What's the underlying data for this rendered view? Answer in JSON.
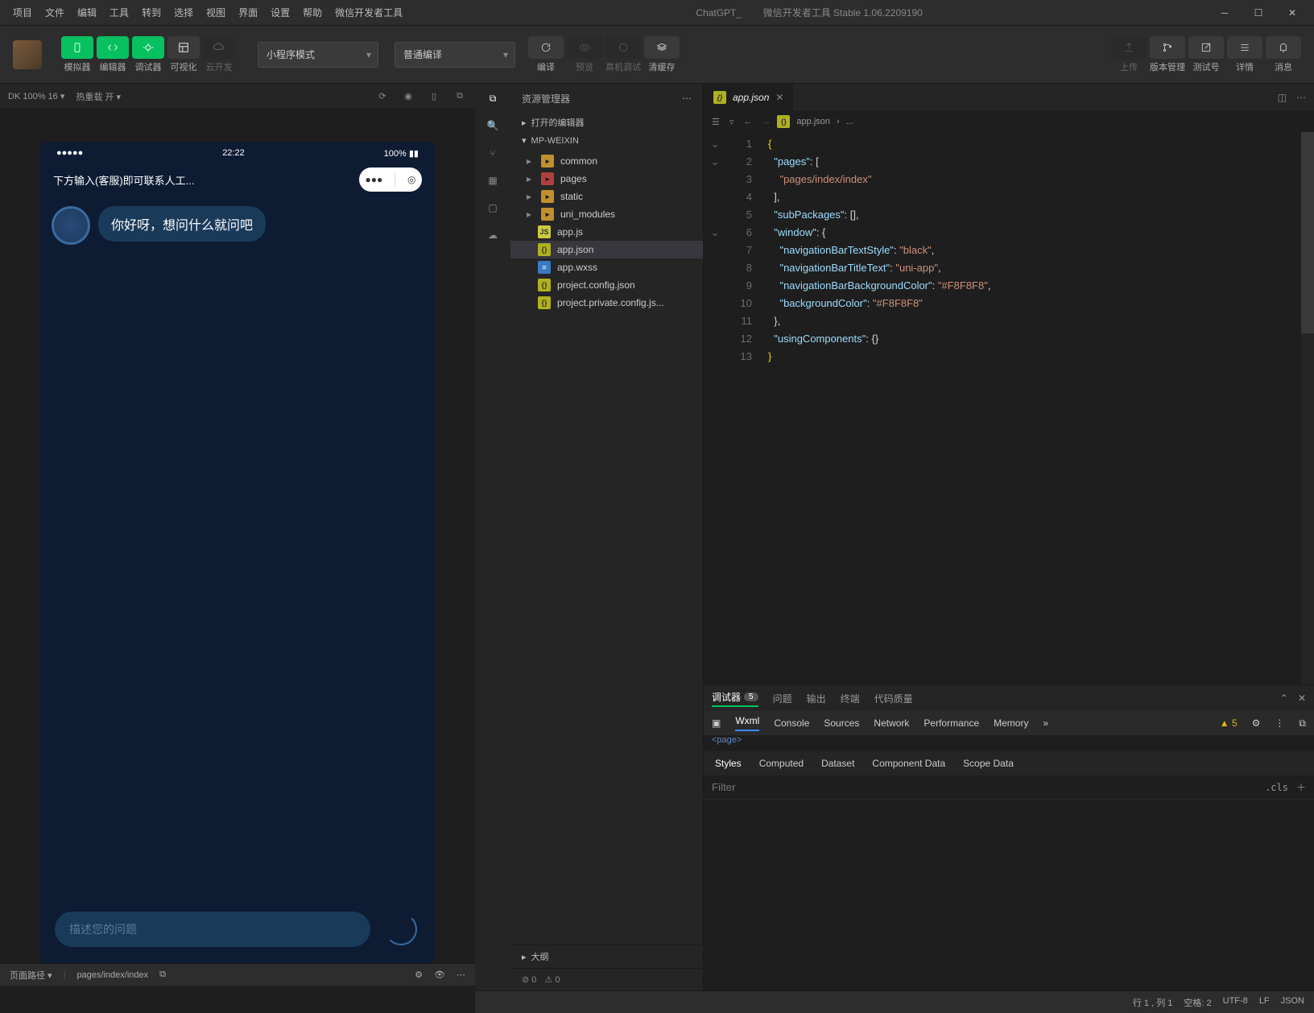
{
  "menu": {
    "items": [
      "项目",
      "文件",
      "编辑",
      "工具",
      "转到",
      "选择",
      "视图",
      "界面",
      "设置",
      "帮助",
      "微信开发者工具"
    ],
    "center_prefix": "ChatGPT_",
    "center_suffix": "微信开发者工具 Stable 1.06.2209190"
  },
  "toolbar": {
    "groups": [
      {
        "label": "模拟器"
      },
      {
        "label": "编辑器"
      },
      {
        "label": "调试器"
      },
      {
        "label": "可视化"
      },
      {
        "label": "云开发"
      }
    ],
    "mode_select": "小程序模式",
    "compile_select": "普通编译",
    "compile": "编译",
    "preview": "预览",
    "real": "真机调试",
    "purge": "清缓存",
    "upload": "上传",
    "version": "版本管理",
    "testnum": "测试号",
    "details": "详情",
    "messages": "消息"
  },
  "simbar": {
    "device": "DK 100% 16",
    "reload": "热重载 开"
  },
  "phone": {
    "status_time": "22:22",
    "status_batt": "100%",
    "title": "下方输入(客服)即可联系人工...",
    "bubble": "你好呀，想问什么就问吧",
    "input_placeholder": "描述您的问题"
  },
  "explorer": {
    "title": "资源管理器",
    "open_editors": "打开的编辑器",
    "project": "MP-WEIXIN",
    "tree": [
      {
        "name": "common",
        "type": "folder"
      },
      {
        "name": "pages",
        "type": "folder-red"
      },
      {
        "name": "static",
        "type": "folder"
      },
      {
        "name": "uni_modules",
        "type": "folder"
      },
      {
        "name": "app.js",
        "type": "js"
      },
      {
        "name": "app.json",
        "type": "json",
        "selected": true
      },
      {
        "name": "app.wxss",
        "type": "css"
      },
      {
        "name": "project.config.json",
        "type": "json"
      },
      {
        "name": "project.private.config.js...",
        "type": "json"
      }
    ],
    "outline": "大纲",
    "errors": "0",
    "warnings": "0"
  },
  "editor": {
    "tab": "app.json",
    "breadcrumb": [
      "app.json",
      "..."
    ],
    "lines": [
      {
        "n": 1,
        "t": "{",
        "cls": "brace"
      },
      {
        "n": 2,
        "t": "  \"pages\": [",
        "key": "pages"
      },
      {
        "n": 3,
        "t": "    \"pages/index/index\"",
        "str": true
      },
      {
        "n": 4,
        "t": "  ],"
      },
      {
        "n": 5,
        "t": "  \"subPackages\": [],",
        "key": "subPackages"
      },
      {
        "n": 6,
        "t": "  \"window\": {",
        "key": "window"
      },
      {
        "n": 7,
        "t": "    \"navigationBarTextStyle\": \"black\",",
        "key": "navigationBarTextStyle",
        "val": "black"
      },
      {
        "n": 8,
        "t": "    \"navigationBarTitleText\": \"uni-app\",",
        "key": "navigationBarTitleText",
        "val": "uni-app"
      },
      {
        "n": 9,
        "t": "    \"navigationBarBackgroundColor\": \"#F8F8F8\",",
        "key": "navigationBarBackgroundColor",
        "val": "#F8F8F8"
      },
      {
        "n": 10,
        "t": "    \"backgroundColor\": \"#F8F8F8\"",
        "key": "backgroundColor",
        "val": "#F8F8F8"
      },
      {
        "n": 11,
        "t": "  },"
      },
      {
        "n": 12,
        "t": "  \"usingComponents\": {}",
        "key": "usingComponents"
      },
      {
        "n": 13,
        "t": "}",
        "cls": "brace"
      }
    ]
  },
  "debugger": {
    "tabs": [
      "调试器",
      "问题",
      "输出",
      "终端",
      "代码质量"
    ],
    "badge": "5",
    "tools": [
      "Wxml",
      "Console",
      "Sources",
      "Network",
      "Performance",
      "Memory"
    ],
    "warn": "5",
    "page_tag": "<page>",
    "styles_tabs": [
      "Styles",
      "Computed",
      "Dataset",
      "Component Data",
      "Scope Data"
    ],
    "filter_placeholder": "Filter",
    "cls": ".cls"
  },
  "status": {
    "page_path_label": "页面路径",
    "page_path": "pages/index/index",
    "pos": "行 1 , 列 1",
    "spaces": "空格: 2",
    "enc": "UTF-8",
    "eol": "LF",
    "lang": "JSON"
  }
}
